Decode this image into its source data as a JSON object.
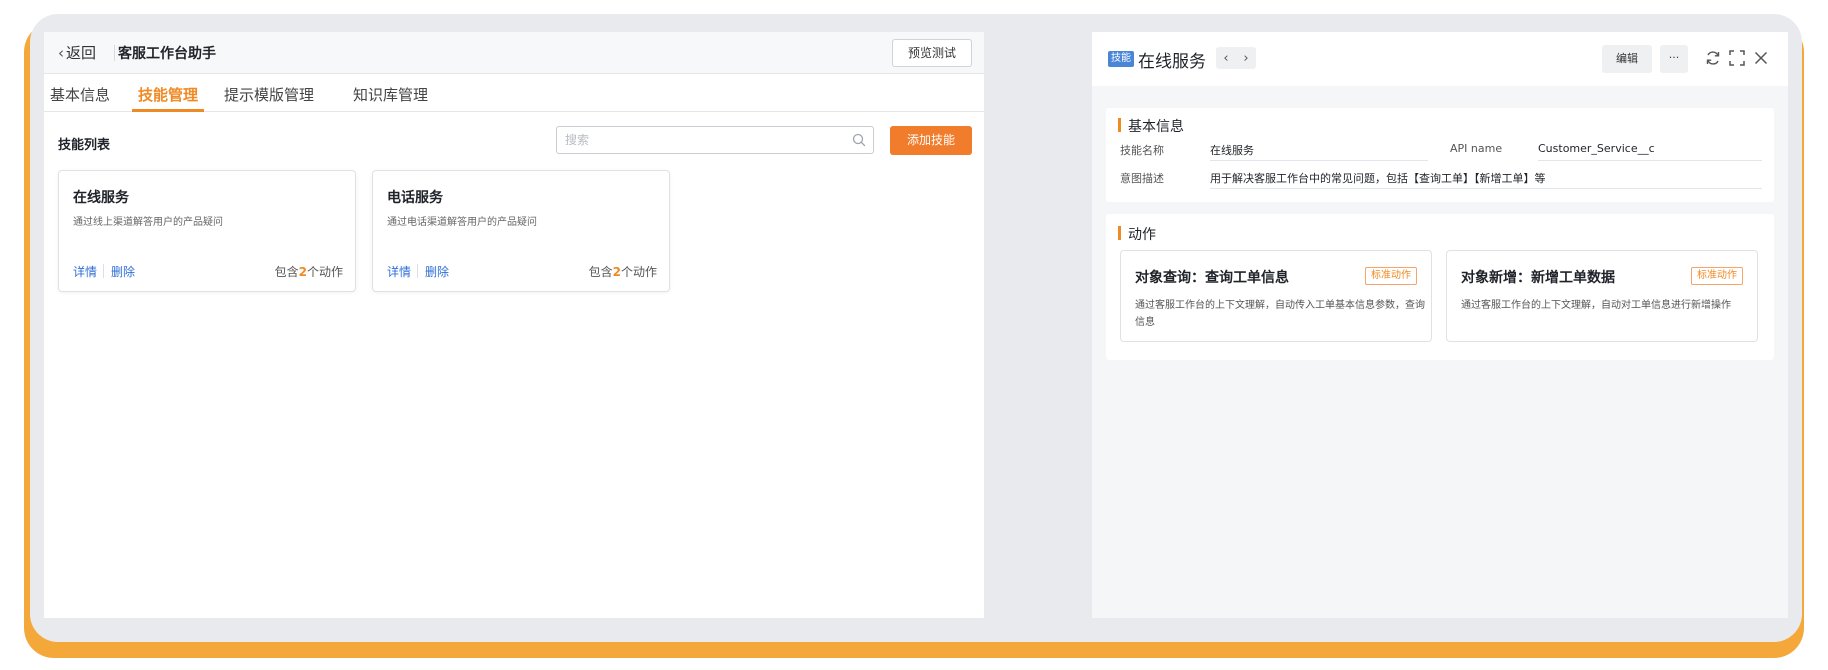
{
  "left": {
    "back_label": "返回",
    "app_title": "客服工作台助手",
    "preview_label": "预览测试",
    "tabs": [
      {
        "label": "基本信息"
      },
      {
        "label": "技能管理"
      },
      {
        "label": "提示模版管理"
      },
      {
        "label": "知识库管理"
      }
    ],
    "active_tab": "技能管理",
    "list_title": "技能列表",
    "search_placeholder": "搜索",
    "add_label": "添加技能",
    "cards": [
      {
        "title": "在线服务",
        "desc": "通过线上渠道解答用户的产品疑问",
        "detail": "详情",
        "delete": "删除",
        "count_prefix": "包含",
        "count": "2",
        "count_suffix": "个动作"
      },
      {
        "title": "电话服务",
        "desc": "通过电话渠道解答用户的产品疑问",
        "detail": "详情",
        "delete": "删除",
        "count_prefix": "包含",
        "count": "2",
        "count_suffix": "个动作"
      }
    ]
  },
  "right": {
    "badge": "技能",
    "title": "在线服务",
    "edit_label": "编辑",
    "more_label": "···",
    "basic": {
      "title": "基本信息",
      "name_label": "技能名称",
      "name_value": "在线服务",
      "api_label": "API name",
      "api_value": "Customer_Service__c",
      "intent_label": "意图描述",
      "intent_value": "用于解决客服工作台中的常见问题，包括【查询工单】【新增工单】等"
    },
    "actions": {
      "title": "动作",
      "items": [
        {
          "title": "对象查询：查询工单信息",
          "tag": "标准动作",
          "desc": "通过客服工作台的上下文理解，自动传入工单基本信息参数，查询信息"
        },
        {
          "title": "对象新增：新增工单数据",
          "tag": "标准动作",
          "desc": "通过客服工作台的上下文理解，自动对工单信息进行新增操作"
        }
      ]
    }
  },
  "colors": {
    "accent": "#f08a24",
    "link": "#2f6fd6",
    "badge": "#4a86d8",
    "frame_bottom": "#f5a83a"
  }
}
